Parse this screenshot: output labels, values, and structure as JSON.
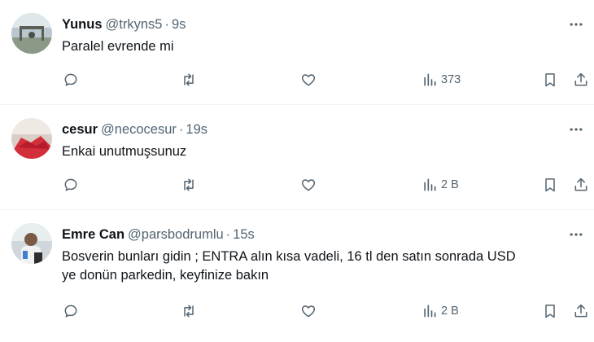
{
  "tweets": [
    {
      "name": "Yunus",
      "handle": "@trkyns5",
      "separator": "·",
      "time": "9s",
      "text_lines": [
        "Paralel evrende mi"
      ],
      "views": "373"
    },
    {
      "name": "cesur",
      "handle": "@necocesur",
      "separator": "·",
      "time": "19s",
      "text_lines": [
        "Enkai unutmuşsunuz"
      ],
      "views": "2 B"
    },
    {
      "name": "Emre Can",
      "handle": "@parsbodrumlu",
      "separator": "·",
      "time": "15s",
      "text_lines": [
        "Bosverin bunları gidin ; ENTRA alın kısa vadeli, 16 tl den satın sonrada USD",
        "ye donün parkedin, keyfinize bakın"
      ],
      "views": "2 B"
    }
  ],
  "icons": {
    "more": "more-icon",
    "reply": "reply-icon",
    "retweet": "retweet-icon",
    "like": "like-icon",
    "views": "views-icon",
    "bookmark": "bookmark-icon",
    "share": "share-icon"
  },
  "colors": {
    "text": "#0f1419",
    "secondary": "#536471",
    "divider": "#eff3f4"
  }
}
